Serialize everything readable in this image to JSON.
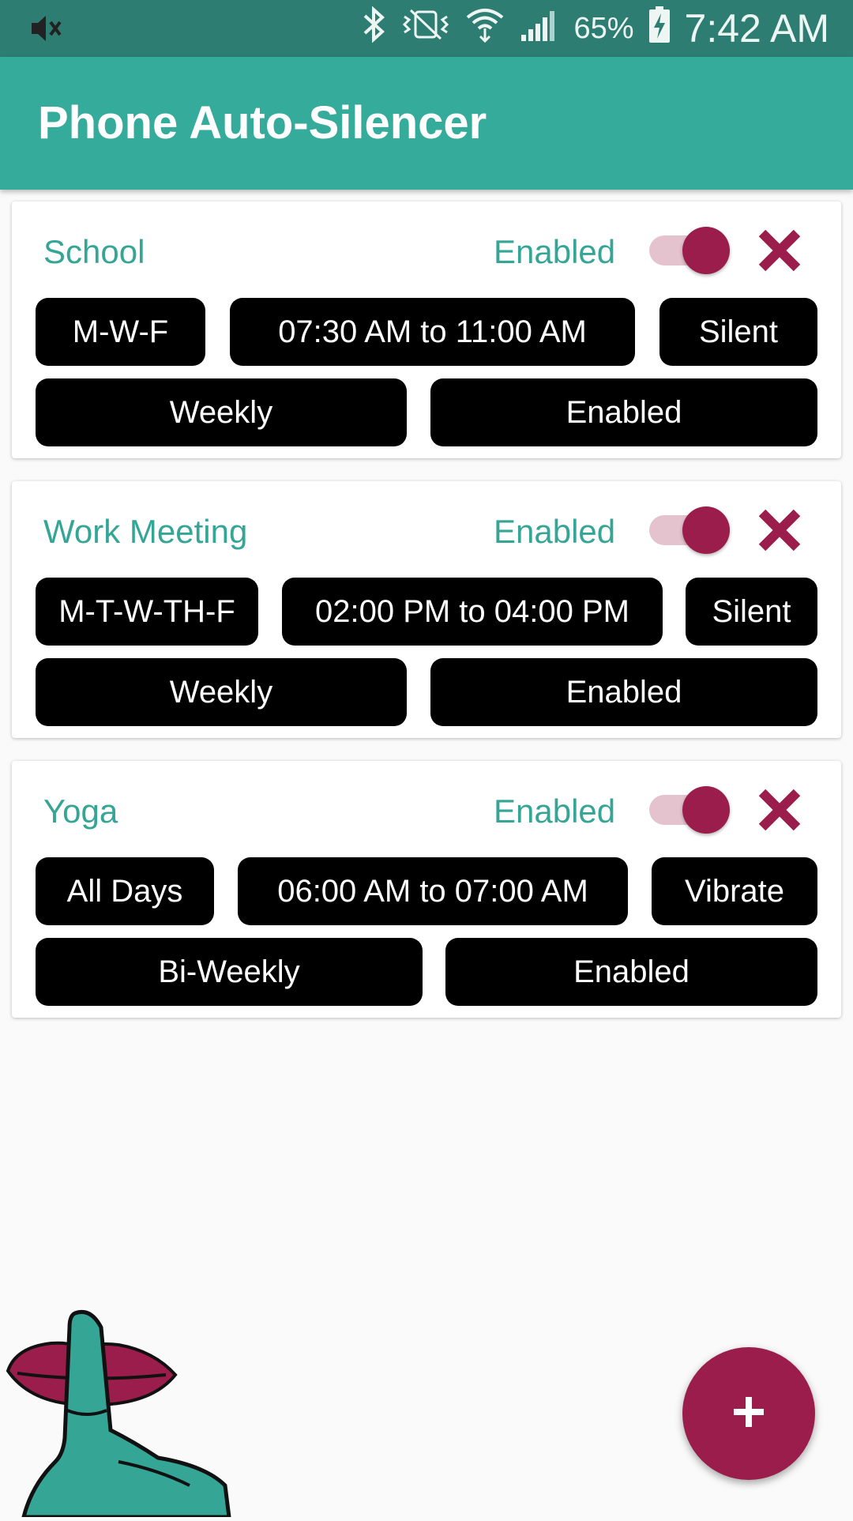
{
  "status_bar": {
    "battery_percent": "65%",
    "time": "7:42 AM",
    "icons": [
      "mute-icon",
      "bluetooth-icon",
      "vibrate-icon",
      "wifi-icon",
      "signal-icon",
      "battery-charging-icon"
    ]
  },
  "app_bar": {
    "title": "Phone Auto-Silencer"
  },
  "schedules": [
    {
      "name": "School",
      "status": "Enabled",
      "toggle_on": true,
      "days": "M-W-F",
      "time_range": "07:30 AM to 11:00 AM",
      "mode": "Silent",
      "repeat": "Weekly",
      "state": "Enabled"
    },
    {
      "name": "Work Meeting",
      "status": "Enabled",
      "toggle_on": true,
      "days": "M-T-W-TH-F",
      "time_range": "02:00 PM to 04:00 PM",
      "mode": "Silent",
      "repeat": "Weekly",
      "state": "Enabled"
    },
    {
      "name": "Yoga",
      "status": "Enabled",
      "toggle_on": true,
      "days": "All Days",
      "time_range": "06:00 AM to 07:00 AM",
      "mode": "Vibrate",
      "repeat": "Bi-Weekly",
      "state": "Enabled"
    }
  ],
  "fab": {
    "icon": "plus-icon"
  },
  "colors": {
    "status_bar": "#2e7d72",
    "app_bar": "#35ab9b",
    "accent_text": "#35a596",
    "primary": "#9b1d4b",
    "toggle_track": "#e4c3cf",
    "pill": "#000000"
  }
}
